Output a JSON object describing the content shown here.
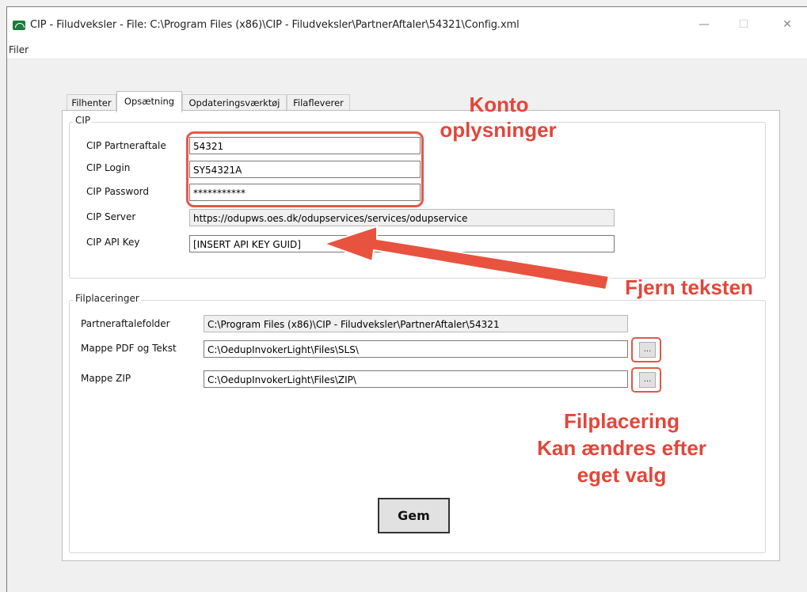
{
  "window": {
    "title": "CIP - Filudveksler - File: C:\\Program Files (x86)\\CIP - Filudveksler\\PartnerAftaler\\54321\\Config.xml",
    "controls": {
      "minimize": "—",
      "maximize": "☐",
      "close": "✕"
    }
  },
  "menu": {
    "items": [
      {
        "label": "Filer"
      }
    ]
  },
  "tabs": [
    {
      "label": "Filhenter",
      "active": false
    },
    {
      "label": "Opsætning",
      "active": true
    },
    {
      "label": "Opdateringsværktøj",
      "active": false
    },
    {
      "label": "Filafleverer",
      "active": false
    }
  ],
  "cip_group": {
    "title": "CIP",
    "fields": {
      "partneraftale": {
        "label": "CIP Partneraftale",
        "value": "54321"
      },
      "login": {
        "label": "CIP Login",
        "value": "SY54321A"
      },
      "password": {
        "label": "CIP Password",
        "value": "***********"
      },
      "server": {
        "label": "CIP Server",
        "value": "https://odupws.oes.dk/odupservices/services/odupservice"
      },
      "api_key": {
        "label": "CIP API Key",
        "value": "[INSERT API KEY GUID]"
      }
    }
  },
  "file_group": {
    "title": "Filplaceringer",
    "fields": {
      "partner_folder": {
        "label": "Partneraftalefolder",
        "value": "C:\\Program Files (x86)\\CIP - Filudveksler\\PartnerAftaler\\54321"
      },
      "pdf_folder": {
        "label": "Mappe PDF og Tekst",
        "value": "C:\\OedupInvokerLight\\Files\\SLS\\",
        "browse": "..."
      },
      "zip_folder": {
        "label": "Mappe ZIP",
        "value": "C:\\OedupInvokerLight\\Files\\ZIP\\",
        "browse": "..."
      }
    }
  },
  "save_button": {
    "label": "Gem"
  },
  "annotations": {
    "konto_line1": "Konto",
    "konto_line2": "oplysninger",
    "fjern": "Fjern teksten",
    "filplacering_line1": "Filplacering",
    "filplacering_line2": "Kan ændres efter",
    "filplacering_line3": "eget valg",
    "color": "#e2463a"
  }
}
